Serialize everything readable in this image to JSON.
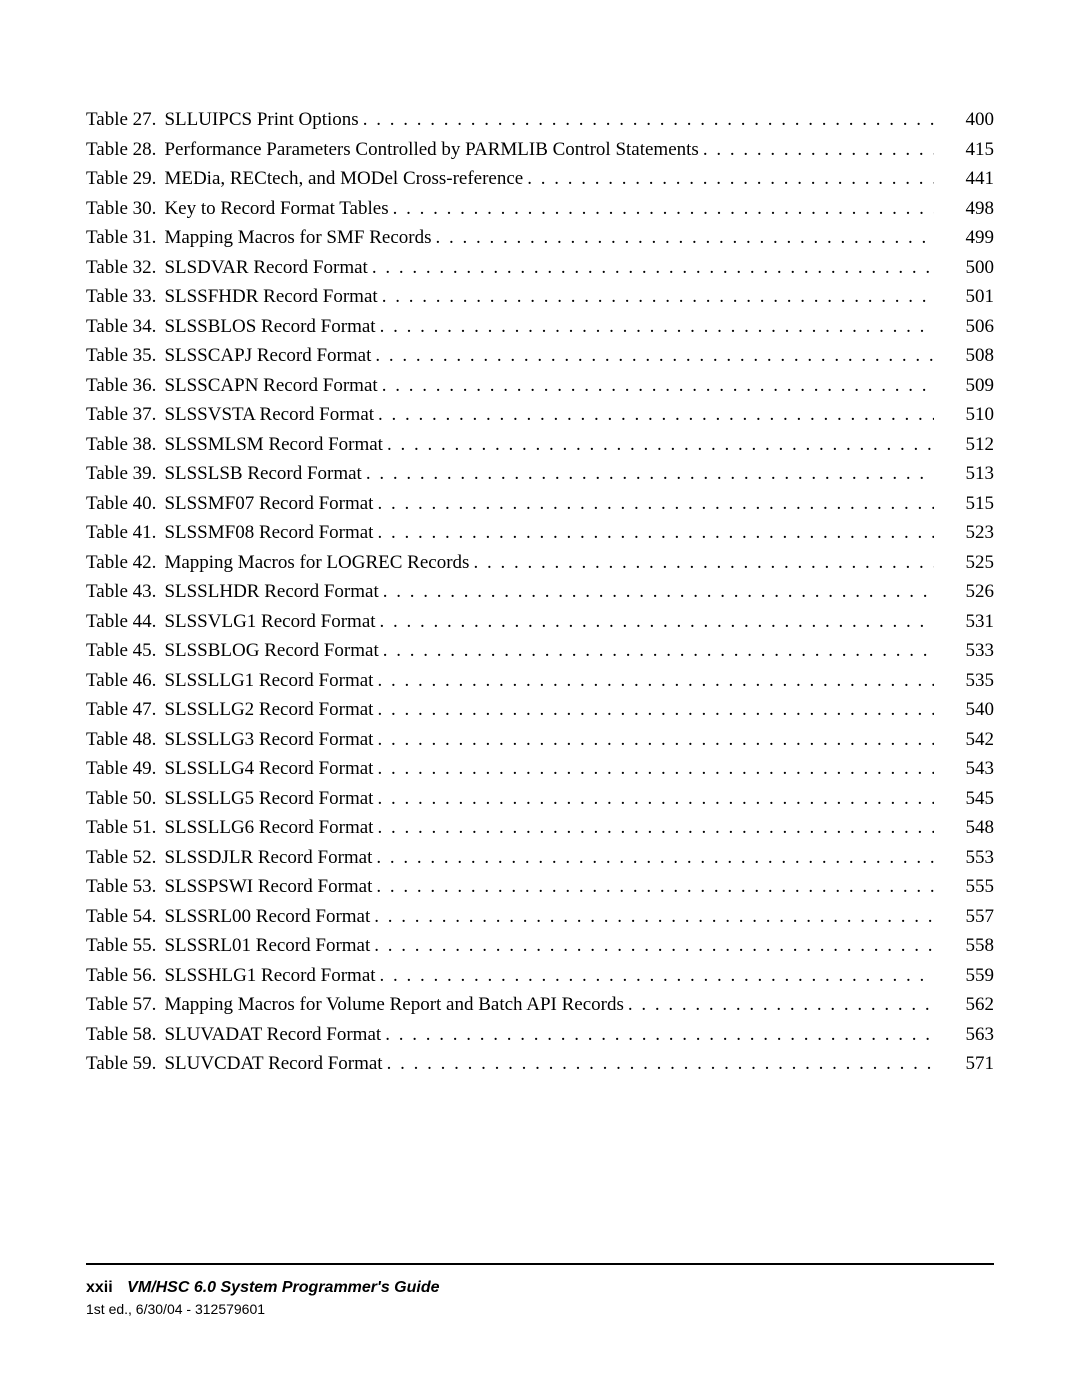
{
  "toc": [
    {
      "label": "Table 27.",
      "title": "SLLUIPCS Print Options",
      "page": "400"
    },
    {
      "label": "Table 28.",
      "title": "Performance Parameters Controlled by PARMLIB Control Statements",
      "page": "415"
    },
    {
      "label": "Table 29.",
      "title": "MEDia, RECtech, and MODel Cross-reference",
      "page": "441"
    },
    {
      "label": "Table 30.",
      "title": "Key to Record Format Tables",
      "page": "498"
    },
    {
      "label": "Table 31.",
      "title": "Mapping Macros for SMF Records",
      "page": "499"
    },
    {
      "label": "Table 32.",
      "title": "SLSDVAR Record Format",
      "page": "500"
    },
    {
      "label": "Table 33.",
      "title": "SLSSFHDR Record Format",
      "page": "501"
    },
    {
      "label": "Table 34.",
      "title": "SLSSBLOS Record Format",
      "page": "506"
    },
    {
      "label": "Table 35.",
      "title": "SLSSCAPJ Record Format",
      "page": "508"
    },
    {
      "label": "Table 36.",
      "title": "SLSSCAPN Record Format",
      "page": "509"
    },
    {
      "label": "Table 37.",
      "title": "SLSSVSTA Record Format",
      "page": "510"
    },
    {
      "label": "Table 38.",
      "title": "SLSSMLSM Record Format",
      "page": "512"
    },
    {
      "label": "Table 39.",
      "title": "SLSSLSB Record Format",
      "page": "513"
    },
    {
      "label": "Table 40.",
      "title": "SLSSMF07 Record Format",
      "page": "515"
    },
    {
      "label": "Table 41.",
      "title": "SLSSMF08 Record Format",
      "page": "523"
    },
    {
      "label": "Table 42.",
      "title": "Mapping Macros for LOGREC Records",
      "page": "525"
    },
    {
      "label": "Table 43.",
      "title": "SLSSLHDR Record Format",
      "page": "526"
    },
    {
      "label": "Table 44.",
      "title": "SLSSVLG1 Record Format",
      "page": "531"
    },
    {
      "label": "Table 45.",
      "title": "SLSSBLOG Record Format",
      "page": "533"
    },
    {
      "label": "Table 46.",
      "title": "SLSSLLG1 Record Format",
      "page": "535"
    },
    {
      "label": "Table 47.",
      "title": "SLSSLLG2 Record Format",
      "page": "540"
    },
    {
      "label": "Table 48.",
      "title": "SLSSLLG3 Record Format",
      "page": "542"
    },
    {
      "label": "Table 49.",
      "title": "SLSSLLG4 Record Format",
      "page": "543"
    },
    {
      "label": "Table 50.",
      "title": "SLSSLLG5 Record Format",
      "page": "545"
    },
    {
      "label": "Table 51.",
      "title": "SLSSLLG6 Record Format",
      "page": "548"
    },
    {
      "label": "Table 52.",
      "title": "SLSSDJLR Record Format",
      "page": "553"
    },
    {
      "label": "Table 53.",
      "title": "SLSSPSWI Record Format",
      "page": "555"
    },
    {
      "label": "Table 54.",
      "title": "SLSSRL00 Record Format",
      "page": "557"
    },
    {
      "label": "Table 55.",
      "title": "SLSSRL01 Record Format",
      "page": "558"
    },
    {
      "label": "Table 56.",
      "title": "SLSSHLG1 Record Format",
      "page": "559"
    },
    {
      "label": "Table 57.",
      "title": "Mapping Macros for Volume Report and Batch API Records",
      "page": "562"
    },
    {
      "label": "Table 58.",
      "title": "SLUVADAT Record Format",
      "page": "563"
    },
    {
      "label": "Table 59.",
      "title": "SLUVCDAT Record Format",
      "page": "571"
    }
  ],
  "footer": {
    "page_number": "xxii",
    "guide_title": "VM/HSC 6.0 System Programmer's Guide",
    "edition": "1st ed., 6/30/04 - 312579601"
  }
}
